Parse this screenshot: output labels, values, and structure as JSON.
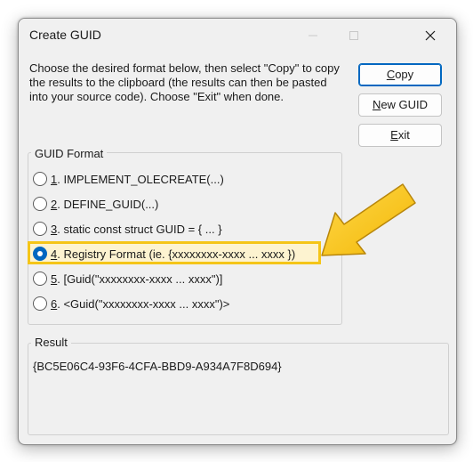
{
  "window": {
    "title": "Create GUID",
    "instructions": "Choose the desired format below, then select \"Copy\" to copy the results to the clipboard (the results can then be pasted into your source code).  Choose \"Exit\" when done."
  },
  "buttons": {
    "copy": {
      "mnemonic": "C",
      "rest": "opy"
    },
    "new_guid": {
      "mnemonic": "N",
      "rest": "ew GUID"
    },
    "exit": {
      "mnemonic": "E",
      "rest": "xit"
    }
  },
  "guid_format": {
    "label": "GUID Format",
    "options": [
      {
        "num": "1",
        "text": ". IMPLEMENT_OLECREATE(...)",
        "checked": false
      },
      {
        "num": "2",
        "text": ". DEFINE_GUID(...)",
        "checked": false
      },
      {
        "num": "3",
        "text": ". static const struct GUID = { ... }",
        "checked": false
      },
      {
        "num": "4",
        "text": ". Registry Format (ie. {xxxxxxxx-xxxx ... xxxx })",
        "checked": true
      },
      {
        "num": "5",
        "text": ". [Guid(\"xxxxxxxx-xxxx ... xxxx\")]",
        "checked": false
      },
      {
        "num": "6",
        "text": ". <Guid(\"xxxxxxxx-xxxx ... xxxx\")>",
        "checked": false
      }
    ]
  },
  "result": {
    "label": "Result",
    "value": "{BC5E06C4-93F6-4CFA-BBD9-A934A7F8D694}"
  },
  "annotation": {
    "highlight_color": "#f5c518",
    "arrow_color": "#f5c518"
  }
}
